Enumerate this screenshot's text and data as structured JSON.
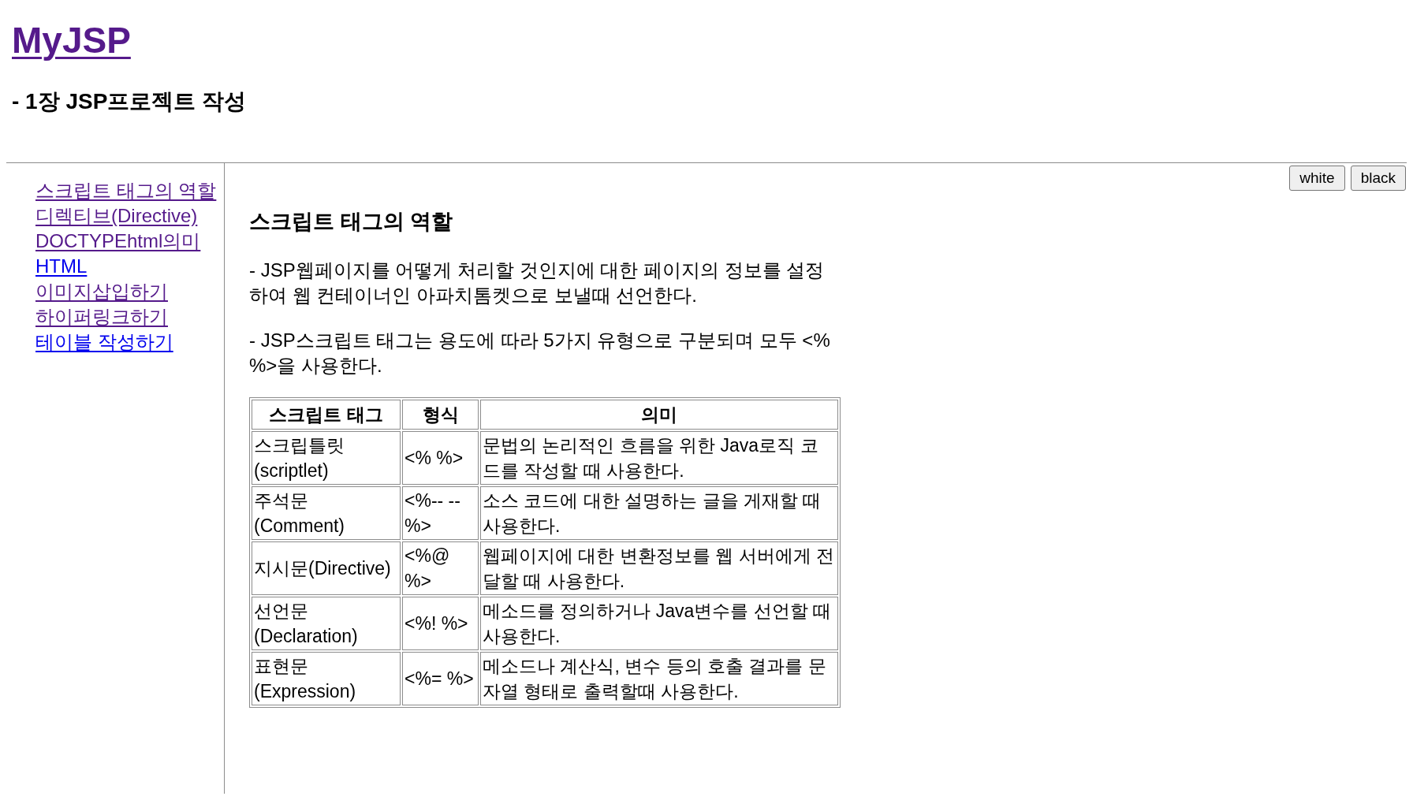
{
  "header": {
    "title": {
      "text": "MyJSP",
      "visited": true
    },
    "subtitle": "- 1장 JSP프로젝트 작성"
  },
  "sidebar": {
    "links": [
      {
        "label": "스크립트 태그의 역할",
        "visited": true
      },
      {
        "label": "디렉티브(Directive)",
        "visited": true
      },
      {
        "label": "DOCTYPEhtml의미",
        "visited": true
      },
      {
        "label": "HTML",
        "visited": false
      },
      {
        "label": "이미지삽입하기",
        "visited": true
      },
      {
        "label": "하이퍼링크하기",
        "visited": true
      },
      {
        "label": "테이블 작성하기",
        "visited": false
      }
    ]
  },
  "theme_buttons": [
    "white",
    "black"
  ],
  "content": {
    "heading": "스크립트 태그의 역할",
    "paragraphs": [
      "- JSP웹페이지를 어떻게 처리할 것인지에 대한 페이지의 정보를 설정하여 웹 컨테이너인 아파치톰켓으로 보낼때 선언한다.",
      "- JSP스크립트 태그는 용도에 따라 5가지 유형으로 구분되며 모두 <% %>을 사용한다."
    ],
    "table": {
      "columns": [
        "스크립트 태그",
        "형식",
        "의미"
      ],
      "rows": [
        [
          "스크립틀릿(scriptlet)",
          "<% %>",
          "문법의 논리적인 흐름을 위한 Java로직 코드를 작성할 때 사용한다."
        ],
        [
          "주석문(Comment)",
          "<%-- --%>",
          "소스 코드에 대한 설명하는 글을 게재할 때 사용한다."
        ],
        [
          "지시문(Directive)",
          "<%@ %>",
          "웹페이지에 대한 변환정보를 웹 서버에게 전달할 때 사용한다."
        ],
        [
          "선언문(Declaration)",
          "<%! %>",
          "메소드를 정의하거나 Java변수를 선언할 때 사용한다."
        ],
        [
          "표현문(Expression)",
          "<%= %>",
          "메소드나 계산식, 변수 등의 호출 결과를 문자열 형태로 출력할때 사용한다."
        ]
      ]
    }
  }
}
